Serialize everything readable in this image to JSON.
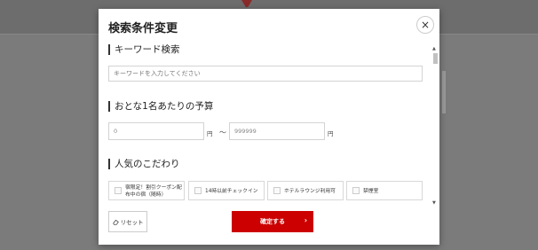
{
  "modal": {
    "title": "検索条件変更",
    "close_icon": "×"
  },
  "keyword": {
    "heading": "キーワード検索",
    "placeholder": "キーワードを入力してください",
    "value": ""
  },
  "budget": {
    "heading": "おとな1名あたりの予算",
    "min_placeholder": "0",
    "max_placeholder": "999999",
    "unit": "円",
    "separator": "〜"
  },
  "popular": {
    "heading": "人気のこだわり",
    "options": [
      {
        "label_line1": "宿限定！割引クーポン配",
        "label_line2": "布中の宿（随時）",
        "checked": false
      },
      {
        "label_line1": "14時以前チェックイン",
        "checked": false
      },
      {
        "label_line1": "ホテルラウンジ利用可",
        "checked": false
      },
      {
        "label_line1": "禁煙室",
        "checked": false
      }
    ]
  },
  "footer": {
    "reset_label": "リセット",
    "reset_icon": "eraser-icon",
    "confirm_label": "確定する",
    "confirm_icon": "chevron-right-icon"
  },
  "colors": {
    "accent": "#cc0000",
    "overlay": "#7b7b7b"
  }
}
